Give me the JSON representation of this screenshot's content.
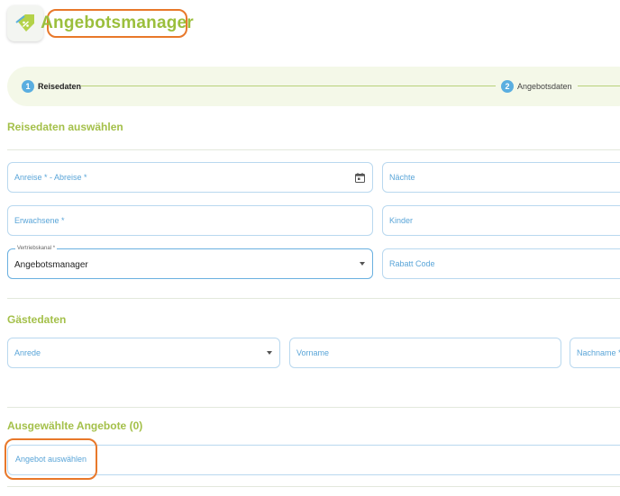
{
  "header": {
    "app_title": "Angebotsmanager",
    "icon": "price-tag-percent-icon"
  },
  "stepper": {
    "steps": [
      {
        "number": "1",
        "label": "Reisedaten",
        "active": true
      },
      {
        "number": "2",
        "label": "Angebotsdaten",
        "active": false
      }
    ]
  },
  "reise": {
    "section_title": "Reisedaten auswählen",
    "dates_placeholder": "Anreise * - Abreise *",
    "nights_placeholder": "Nächte",
    "adults_placeholder": "Erwachsene *",
    "children_placeholder": "Kinder",
    "channel_label": "Vertriebskanal *",
    "channel_value": "Angebotsmanager",
    "discount_placeholder": "Rabatt Code"
  },
  "guest": {
    "section_title": "Gästedaten",
    "salutation_placeholder": "Anrede",
    "firstname_placeholder": "Vorname",
    "lastname_placeholder": "Nachname *"
  },
  "offers": {
    "section_title": "Ausgewählte Angebote (0)",
    "select_button": "Angebot auswählen"
  },
  "colors": {
    "accent_green": "#9bbf3c",
    "step_blue": "#5aaee0",
    "highlight_orange": "#e8782a",
    "field_border": "#b9d8ef"
  }
}
